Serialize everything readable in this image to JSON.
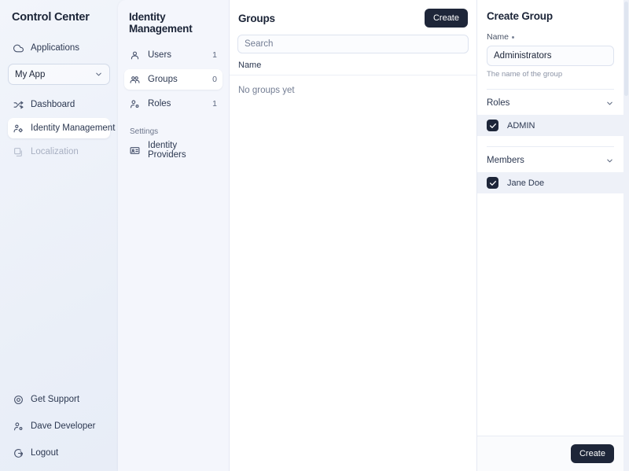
{
  "sidebar": {
    "title": "Control Center",
    "applications": {
      "label": "Applications",
      "icon": "cloud-icon"
    },
    "app_select": {
      "value": "My App",
      "icon": "chevron-down-icon"
    },
    "items": [
      {
        "label": "Dashboard",
        "icon": "activity-icon",
        "selected": false
      },
      {
        "label": "Identity Management",
        "icon": "users-cog-icon",
        "selected": true
      },
      {
        "label": "Localization",
        "icon": "translate-icon",
        "selected": false,
        "disabled": true
      }
    ],
    "bottom_items": [
      {
        "label": "Get Support",
        "icon": "lifebuoy-icon"
      },
      {
        "label": "Dave Developer",
        "icon": "user-cog-icon"
      },
      {
        "label": "Logout",
        "icon": "logout-icon"
      }
    ]
  },
  "identity_panel": {
    "title": "Identity Management",
    "items": [
      {
        "label": "Users",
        "count": "1",
        "icon": "user-icon",
        "selected": false
      },
      {
        "label": "Groups",
        "count": "0",
        "icon": "users-group-icon",
        "selected": true
      },
      {
        "label": "Roles",
        "count": "1",
        "icon": "user-cog-icon",
        "selected": false
      }
    ],
    "section_label": "Settings",
    "settings_items": [
      {
        "label": "Identity Providers",
        "icon": "id-card-icon"
      }
    ]
  },
  "groups_panel": {
    "title": "Groups",
    "create_label": "Create",
    "search_placeholder": "Search",
    "search_value": "",
    "column_header": "Name",
    "empty_message": "No groups yet"
  },
  "create_group": {
    "title": "Create Group",
    "name_label": "Name",
    "name_required": true,
    "name_value": "Administrators",
    "name_hint": "The name of the group",
    "roles_section": {
      "label": "Roles",
      "icon": "chevron-down-icon"
    },
    "roles": [
      {
        "label": "ADMIN",
        "checked": true
      }
    ],
    "members_section": {
      "label": "Members",
      "icon": "chevron-down-icon"
    },
    "members": [
      {
        "label": "Jane Doe",
        "checked": true
      }
    ],
    "submit_label": "Create"
  },
  "colors": {
    "accent_dark": "#1e2639",
    "panel_bg": "#ffffff",
    "sidebar_bg": "#eef1f8",
    "row_highlight": "#eef1f8"
  }
}
